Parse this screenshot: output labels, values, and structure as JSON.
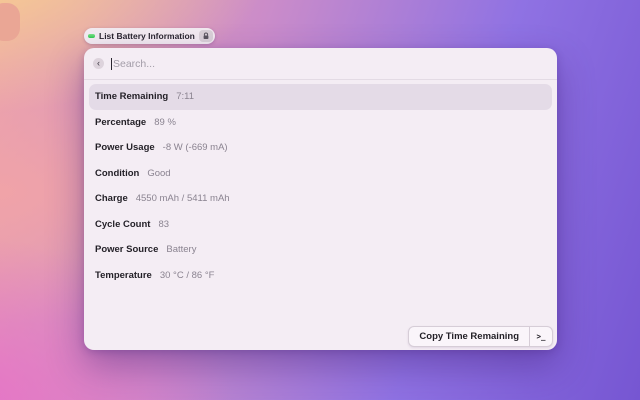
{
  "header_pill": {
    "title": "List Battery Information",
    "icon_color": "#2ec94e"
  },
  "search": {
    "placeholder": "Search..."
  },
  "rows": [
    {
      "label": "Time Remaining",
      "value": "7:11",
      "selected": true
    },
    {
      "label": "Percentage",
      "value": "89 %"
    },
    {
      "label": "Power Usage",
      "value": "-8 W (-669 mA)"
    },
    {
      "label": "Condition",
      "value": "Good"
    },
    {
      "label": "Charge",
      "value": "4550 mAh / 5411 mAh"
    },
    {
      "label": "Cycle Count",
      "value": "83"
    },
    {
      "label": "Power Source",
      "value": "Battery"
    },
    {
      "label": "Temperature",
      "value": "30 °C / 86 °F"
    }
  ],
  "action_bar": {
    "primary_label": "Copy Time Remaining",
    "terminal_icon": ">_"
  },
  "icons": {
    "back": "‹"
  }
}
